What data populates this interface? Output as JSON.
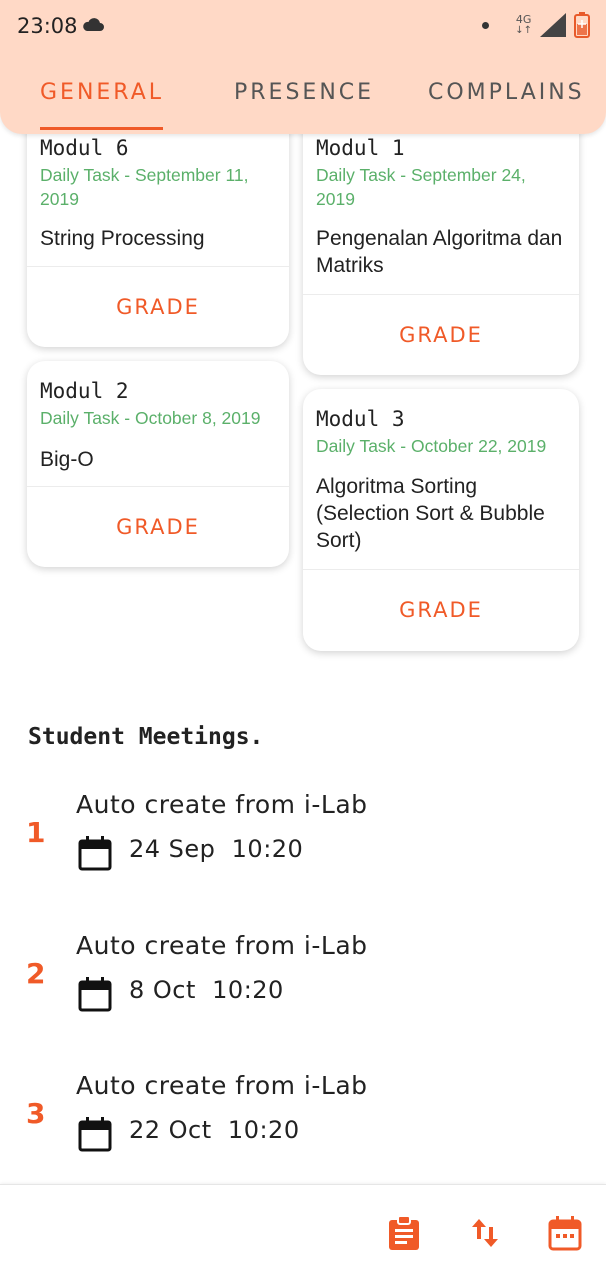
{
  "status_bar": {
    "time": "23:08",
    "network": "4G",
    "icons": [
      "cloud-icon",
      "dot-icon",
      "signal-icon",
      "battery-icon"
    ]
  },
  "tabs": [
    {
      "label": "GENERAL",
      "active": true
    },
    {
      "label": "PRESENCE",
      "active": false
    },
    {
      "label": "COMPLAINS",
      "active": false
    }
  ],
  "colors": {
    "accent": "#F05A28",
    "header_bg": "#FFD9C6",
    "date_green": "#5BB06A",
    "text": "#222222"
  },
  "modules": [
    {
      "title": "Modul 6",
      "date": "Daily Task - September 11, 2019",
      "name": "String Processing",
      "action": "GRADE"
    },
    {
      "title": "Modul 1",
      "date": "Daily Task - September 24, 2019",
      "name": "Pengenalan Algoritma dan Matriks",
      "action": "GRADE"
    },
    {
      "title": "Modul 2",
      "date": "Daily Task - October 8, 2019",
      "name": "Big-O",
      "action": "GRADE"
    },
    {
      "title": "Modul 3",
      "date": "Daily Task - October 22, 2019",
      "name": "Algoritma Sorting (Selection Sort & Bubble Sort)",
      "action": "GRADE"
    }
  ],
  "meetings": {
    "title": "Student Meetings.",
    "items": [
      {
        "number": "1",
        "title": "Auto create from i-Lab",
        "datetime": "24 Sep  10:20"
      },
      {
        "number": "2",
        "title": "Auto create from i-Lab",
        "datetime": "8 Oct  10:20"
      },
      {
        "number": "3",
        "title": "Auto create from i-Lab",
        "datetime": "22 Oct  10:20"
      }
    ]
  },
  "bottom_bar": {
    "icons": [
      "clipboard-icon",
      "sort-icon",
      "calendar-icon"
    ]
  }
}
